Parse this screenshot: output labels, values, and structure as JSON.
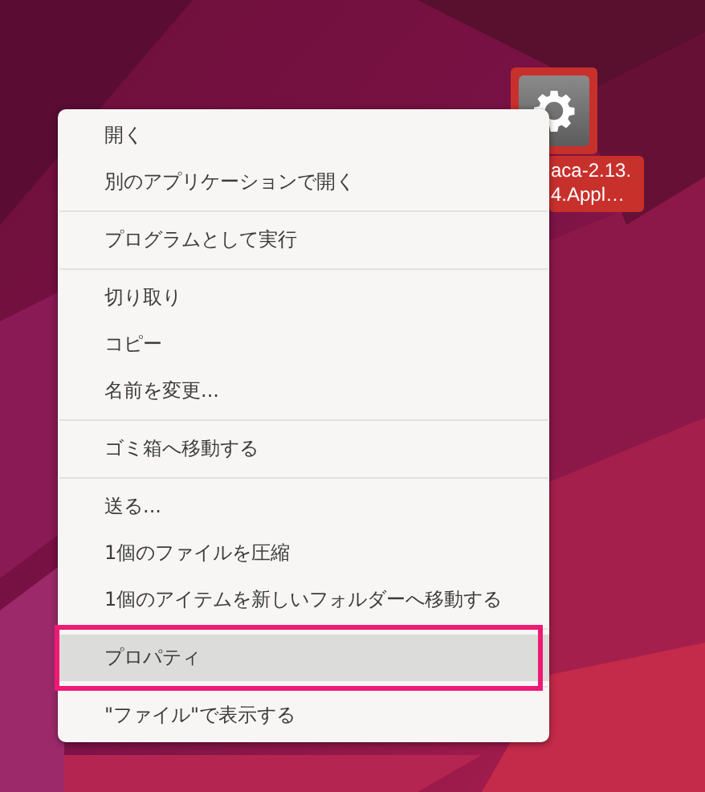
{
  "desktop_icon": {
    "selected": true,
    "label_lines": [
      "aca-2.13.",
      "4.Appl…"
    ]
  },
  "menu": {
    "items": [
      {
        "kind": "item",
        "label": "開く",
        "selected": false,
        "marked": false
      },
      {
        "kind": "item",
        "label": "別のアプリケーションで開く",
        "selected": false,
        "marked": false
      },
      {
        "kind": "separator"
      },
      {
        "kind": "item",
        "label": "プログラムとして実行",
        "selected": false,
        "marked": false
      },
      {
        "kind": "separator"
      },
      {
        "kind": "item",
        "label": "切り取り",
        "selected": false,
        "marked": false
      },
      {
        "kind": "item",
        "label": "コピー",
        "selected": false,
        "marked": false
      },
      {
        "kind": "item",
        "label": "名前を変更...",
        "selected": false,
        "marked": false
      },
      {
        "kind": "separator"
      },
      {
        "kind": "item",
        "label": "ゴミ箱へ移動する",
        "selected": false,
        "marked": false
      },
      {
        "kind": "separator"
      },
      {
        "kind": "item",
        "label": "送る...",
        "selected": false,
        "marked": false
      },
      {
        "kind": "item",
        "label": "1個のファイルを圧縮",
        "selected": false,
        "marked": false
      },
      {
        "kind": "item",
        "label": "1個のアイテムを新しいフォルダーへ移動する",
        "selected": false,
        "marked": false
      },
      {
        "kind": "separator"
      },
      {
        "kind": "item",
        "label": "プロパティ",
        "selected": true,
        "marked": true
      },
      {
        "kind": "separator"
      },
      {
        "kind": "item",
        "label": "\"ファイル\"で表示する",
        "selected": false,
        "marked": false
      }
    ]
  }
}
